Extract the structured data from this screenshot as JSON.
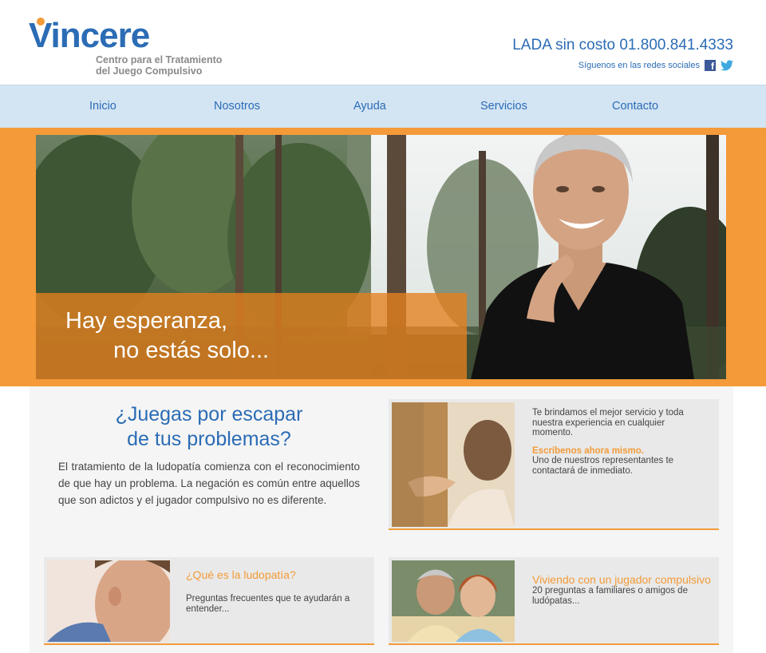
{
  "header": {
    "logo_text": "Vincere",
    "logo_subtitle_1": "Centro para el Tratamiento",
    "logo_subtitle_2": "del Juego Compulsivo",
    "phone": "LADA sin costo 01.800.841.4333",
    "social_text": "Síguenos en las redes sociales"
  },
  "nav": {
    "items": [
      {
        "label": "Inicio"
      },
      {
        "label": "Nosotros"
      },
      {
        "label": "Ayuda"
      },
      {
        "label": "Servicios"
      },
      {
        "label": "Contacto"
      }
    ]
  },
  "banner": {
    "line1": "Hay esperanza,",
    "line2": "no estás solo..."
  },
  "main": {
    "title_1": "¿Juegas por escapar",
    "title_2": "de tus problemas?",
    "body": "El tratamiento de la ludopatía comienza con el reconocimiento de que hay un problema. La negación es común entre aquellos que son adictos y el jugador compulsivo no es diferente."
  },
  "cards": {
    "service": {
      "text": "Te brindamos el mejor servicio y toda nuestra experiencia en cualquier momento.",
      "cta": "Escríbenos ahora mismo.",
      "cta_text": "Uno de nuestros representantes te contactará de inmediato."
    },
    "ludopatia": {
      "title": "¿Qué es la ludopatía?",
      "text": "Preguntas frecuentes que te ayudarán a entender..."
    },
    "viviendo": {
      "title": "Viviendo con un jugador compulsivo",
      "text": "20 preguntas a familiares o amigos de ludópatas..."
    }
  },
  "colors": {
    "brand_blue": "#2b6cb5",
    "brand_orange": "#f29b39",
    "nav_bg": "#d3e4f3"
  },
  "icons": [
    "facebook-icon",
    "twitter-icon"
  ]
}
